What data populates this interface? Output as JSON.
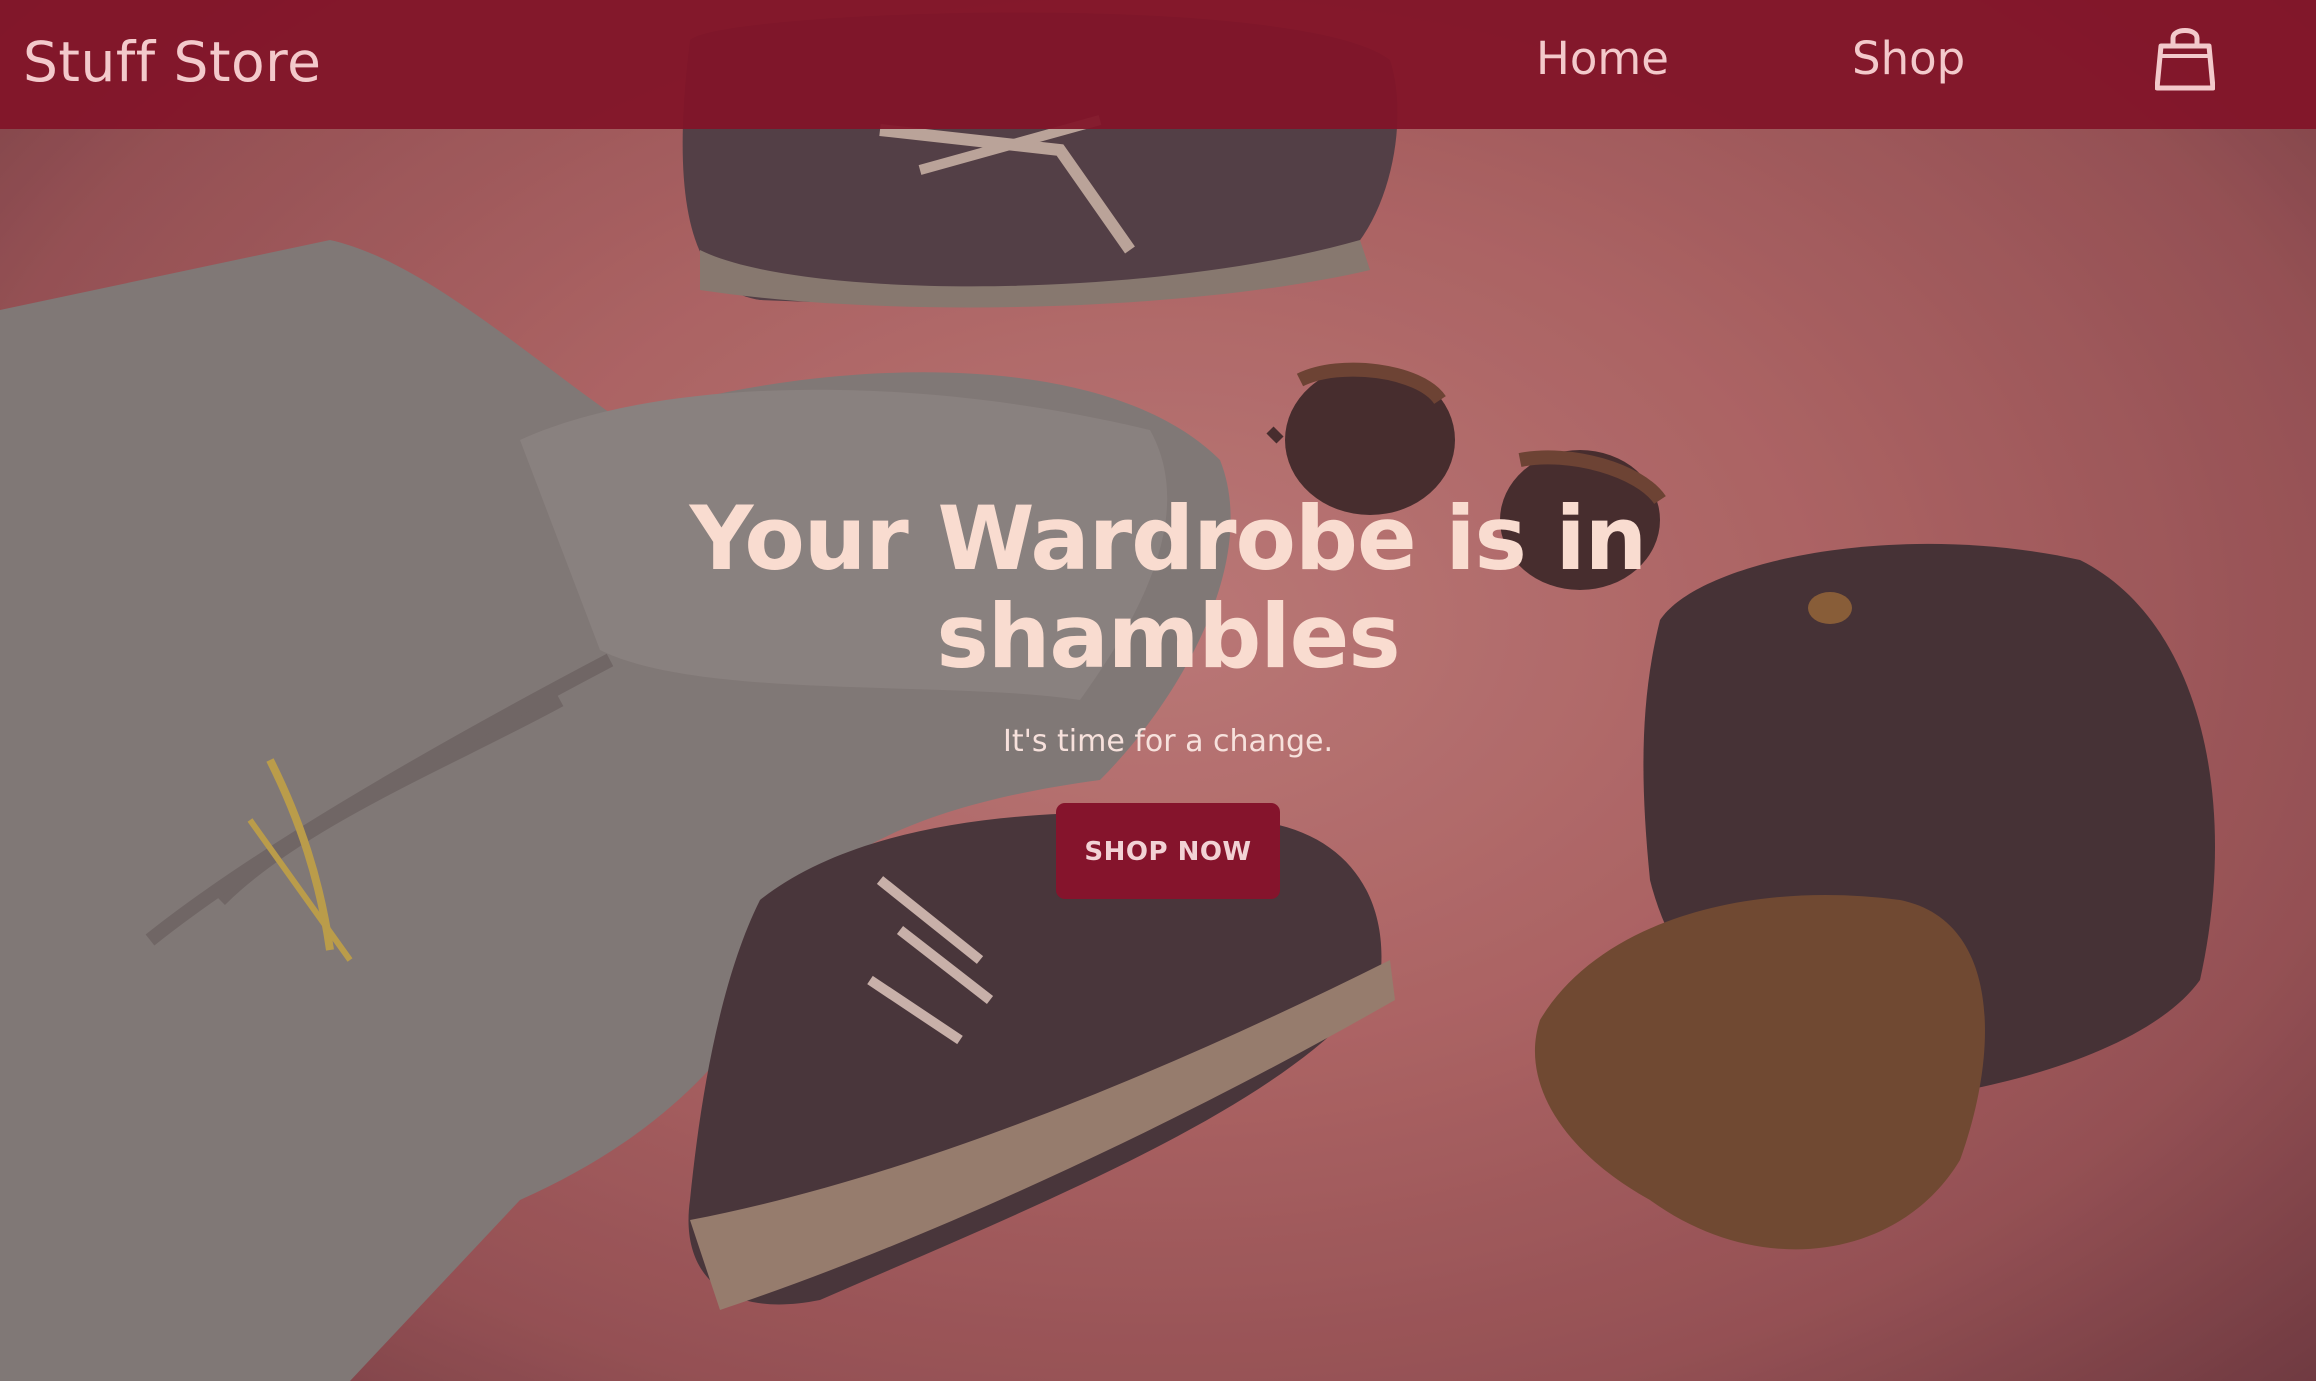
{
  "navbar": {
    "brand": "Stuff Store",
    "links": [
      {
        "label": "Home"
      },
      {
        "label": "Shop"
      }
    ],
    "cart_icon": "shopping-bag-icon"
  },
  "hero": {
    "title": "Your Wardrobe is in shambles",
    "subtitle": "It's time for a change.",
    "cta_label": "SHOP NOW",
    "background_image": "flat-lay-apparel-photo"
  },
  "colors": {
    "navbar": "#82142a",
    "accent": "#85142c",
    "nav_text": "#f3c9cb",
    "hero_title": "#f9dcd0",
    "hero_background": "#b7716f"
  }
}
